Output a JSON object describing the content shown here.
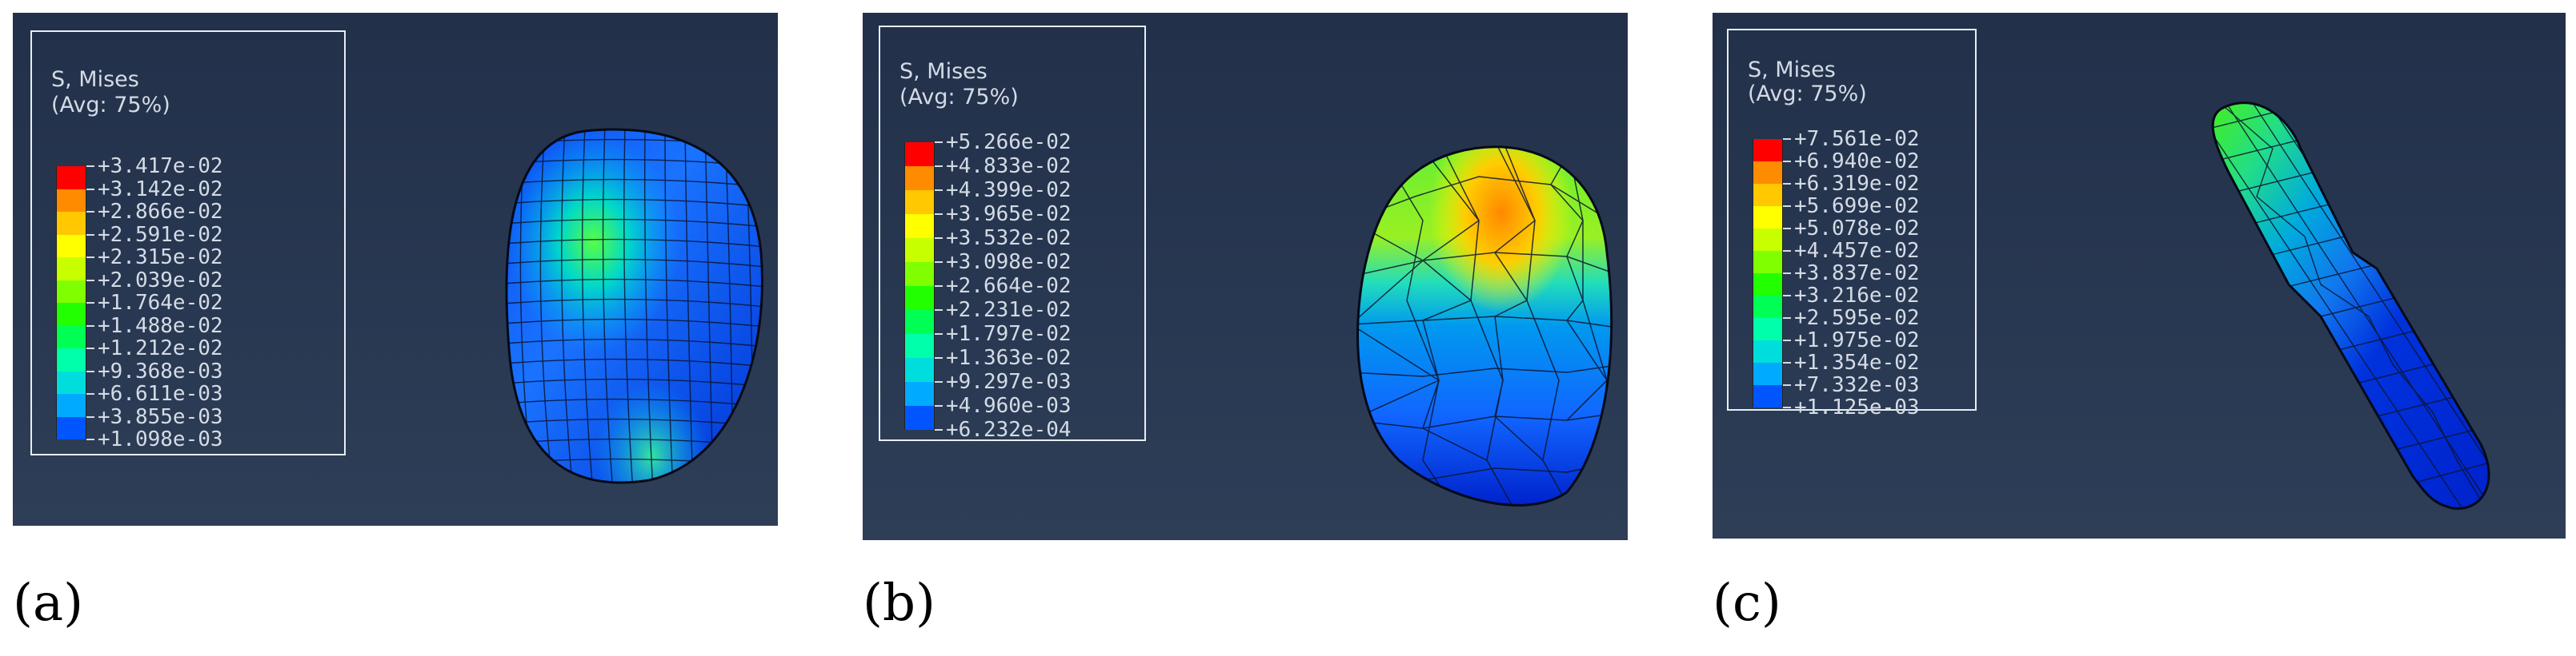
{
  "colors": {
    "background_top": "#22304a",
    "background_bottom": "#2e3e57",
    "contour_scale": [
      "#0000ff",
      "#0055ff",
      "#00aaff",
      "#00dddd",
      "#00ffaa",
      "#00ff55",
      "#22ff00",
      "#7fff00",
      "#c8ff00",
      "#ffff00",
      "#ffc800",
      "#ff8c00",
      "#ff0000"
    ]
  },
  "panels": [
    {
      "id": "a",
      "caption": "(a)",
      "legend_title_line1": "S, Mises",
      "legend_title_line2": "(Avg: 75%)",
      "values": [
        "+3.417e-02",
        "+3.142e-02",
        "+2.866e-02",
        "+2.591e-02",
        "+2.315e-02",
        "+2.039e-02",
        "+1.764e-02",
        "+1.488e-02",
        "+1.212e-02",
        "+9.368e-03",
        "+6.611e-03",
        "+3.855e-03",
        "+1.098e-03"
      ]
    },
    {
      "id": "b",
      "caption": "(b)",
      "legend_title_line1": "S, Mises",
      "legend_title_line2": "(Avg: 75%)",
      "values": [
        "+5.266e-02",
        "+4.833e-02",
        "+4.399e-02",
        "+3.965e-02",
        "+3.532e-02",
        "+3.098e-02",
        "+2.664e-02",
        "+2.231e-02",
        "+1.797e-02",
        "+1.363e-02",
        "+9.297e-03",
        "+4.960e-03",
        "+6.232e-04"
      ]
    },
    {
      "id": "c",
      "caption": "(c)",
      "legend_title_line1": "S, Mises",
      "legend_title_line2": "(Avg: 75%)",
      "values": [
        "+7.561e-02",
        "+6.940e-02",
        "+6.319e-02",
        "+5.699e-02",
        "+5.078e-02",
        "+4.457e-02",
        "+3.837e-02",
        "+3.216e-02",
        "+2.595e-02",
        "+1.975e-02",
        "+1.354e-02",
        "+7.332e-03",
        "+1.125e-03"
      ]
    }
  ]
}
